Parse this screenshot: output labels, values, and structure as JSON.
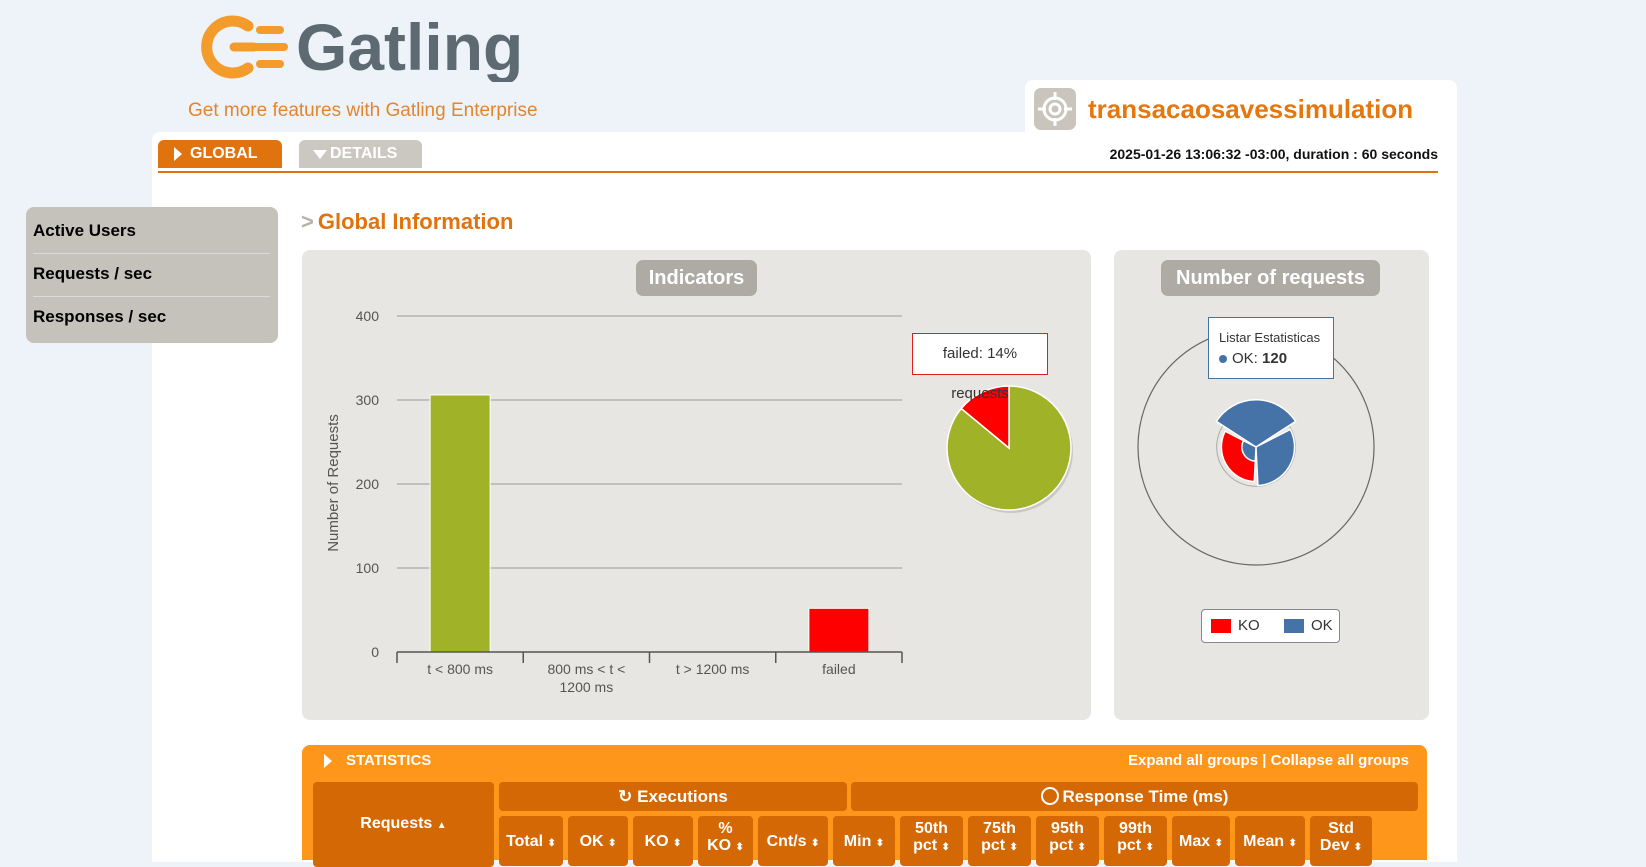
{
  "header": {
    "logo_text": "Gatling",
    "enterprise_link": "Get more features with Gatling Enterprise",
    "simulation_name": "transacaosavessimulation",
    "run_info": "2025-01-26 13:06:32 -03:00, duration : 60 seconds"
  },
  "tabs": {
    "global": "GLOBAL",
    "details": "DETAILS"
  },
  "sidebar": {
    "items": [
      {
        "label": "Active Users"
      },
      {
        "label": "Requests / sec"
      },
      {
        "label": "Responses / sec"
      }
    ]
  },
  "section": {
    "gt": ">",
    "title": "Global Information"
  },
  "indicators": {
    "label": "Indicators",
    "tooltip": "failed: 14% requests"
  },
  "requests_panel": {
    "label": "Number of requests",
    "tooltip_title": "Listar Estatisticas",
    "tooltip_series": "OK: ",
    "tooltip_value": "120",
    "legend": [
      "KO",
      "OK"
    ]
  },
  "statistics": {
    "title": "STATISTICS",
    "expand": "Expand all groups",
    "sep": " | ",
    "collapse": "Collapse all groups",
    "requests_header": "Requests",
    "executions_header": "Executions",
    "response_header": "Response Time (ms)",
    "columns": [
      {
        "line1": "Total",
        "line2": ""
      },
      {
        "line1": "OK",
        "line2": ""
      },
      {
        "line1": "KO",
        "line2": ""
      },
      {
        "line1": "%",
        "line2": "KO"
      },
      {
        "line1": "Cnt/s",
        "line2": ""
      },
      {
        "line1": "Min",
        "line2": ""
      },
      {
        "line1": "50th",
        "line2": "pct"
      },
      {
        "line1": "75th",
        "line2": "pct"
      },
      {
        "line1": "95th",
        "line2": "pct"
      },
      {
        "line1": "99th",
        "line2": "pct"
      },
      {
        "line1": "Max",
        "line2": ""
      },
      {
        "line1": "Mean",
        "line2": ""
      },
      {
        "line1": "Std",
        "line2": "Dev"
      }
    ]
  },
  "colors": {
    "accent": "#e0730e",
    "ok_bar": "#a0b228",
    "ko": "#ff0000",
    "ok_series": "#4572a7"
  },
  "chart_data": [
    {
      "type": "bar",
      "categories": [
        "t < 800 ms",
        "800 ms < t < 1200 ms",
        "t > 1200 ms",
        "failed"
      ],
      "category_lines": [
        [
          "t < 800 ms"
        ],
        [
          "800 ms < t <",
          "1200 ms"
        ],
        [
          "t > 1200 ms"
        ],
        [
          "failed"
        ]
      ],
      "values": [
        306,
        0,
        0,
        52
      ],
      "colors": [
        "#a0b228",
        "#a0b228",
        "#a0b228",
        "#ff0000"
      ],
      "ylabel": "Number of Requests",
      "ylim": [
        0,
        400
      ],
      "yticks": [
        0,
        100,
        200,
        300,
        400
      ],
      "grid": true
    },
    {
      "type": "pie",
      "labels": [
        "OK",
        "failed"
      ],
      "values": [
        86,
        14
      ],
      "colors": [
        "#a0b228",
        "#ff0000"
      ]
    },
    {
      "type": "polar-bar",
      "angular_categories": 3,
      "radial_ticks": [
        0,
        100
      ],
      "series": [
        {
          "name": "KO",
          "values": [
            0,
            0,
            52
          ],
          "color": "#ff0000"
        },
        {
          "name": "OK",
          "values": [
            120,
            98,
            36
          ],
          "color": "#4572a7"
        }
      ]
    }
  ]
}
